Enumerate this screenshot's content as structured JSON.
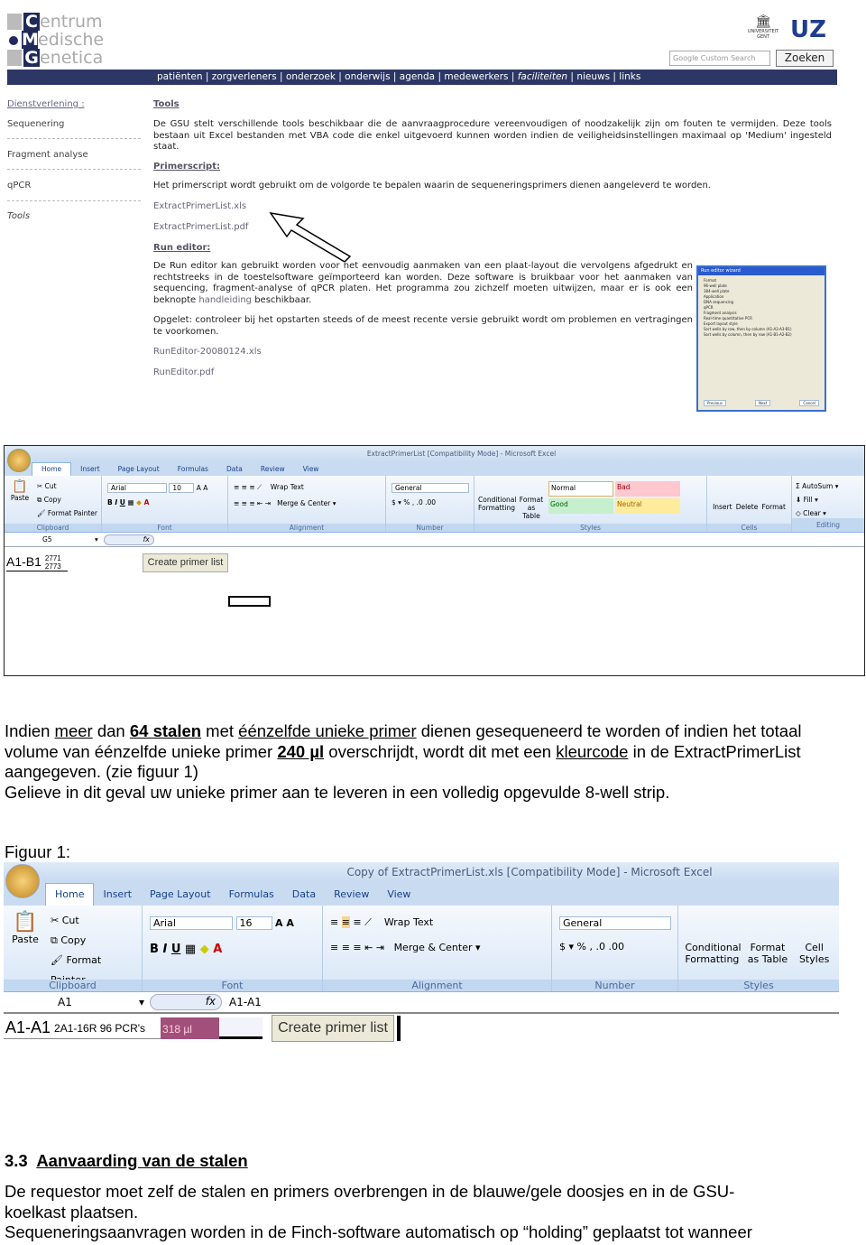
{
  "website": {
    "logo": {
      "line1_initial": "C",
      "line1_rest": "entrum",
      "line2_initial": "M",
      "line2_rest": "edische",
      "line3_initial": "G",
      "line3_rest": "enetica"
    },
    "university_logo": "UNIVERSITEIT GENT",
    "uz_logo": "UZ",
    "search_placeholder": "Google Custom Search",
    "search_button": "Zoeken",
    "nav": [
      "patiënten",
      "zorgverleners",
      "onderzoek",
      "onderwijs",
      "agenda",
      "medewerkers",
      "faciliteiten",
      "nieuws",
      "links"
    ],
    "sidebar": {
      "title": "Dienstverlening :",
      "items": [
        "Sequenering",
        "Fragment analyse",
        "qPCR",
        "Tools"
      ]
    },
    "content": {
      "title": "Tools",
      "intro": "De GSU stelt verschillende tools beschikbaar die de aanvraagprocedure vereenvoudigen of noodzakelijk zijn om fouten te vermijden. Deze tools bestaan uit Excel bestanden met VBA code die enkel uitgevoerd kunnen worden indien de veiligheidsinstellingen maximaal op 'Medium' ingesteld staat.",
      "primerscript_title": "Primerscript:",
      "primerscript_text": "Het primerscript wordt gebruikt om de volgorde te bepalen waarin de sequeneringsprimers dienen aangeleverd te worden.",
      "primer_links": [
        "ExtractPrimerList.xls",
        "ExtractPrimerList.pdf"
      ],
      "runeditor_title": "Run editor:",
      "runeditor_text_before": "De Run editor kan gebruikt worden voor het eenvoudig aanmaken van een plaat-layout die vervolgens afgedrukt en rechtstreeks in de toestelsoftware geïmporteerd kan worden. Deze software is bruikbaar voor het aanmaken van sequencing, fragment-analyse of qPCR platen. Het programma zou zichzelf moeten uitwijzen, maar er is ook een beknopte ",
      "runeditor_link": "handleiding",
      "runeditor_text_after": " beschikbaar.",
      "warning": "Opgelet: controleer bij het opstarten steeds of de meest recente versie gebruikt wordt om problemen en vertragingen te voorkomen.",
      "runeditor_links": [
        "RunEditor-20080124.xls",
        "RunEditor.pdf"
      ]
    },
    "dialog": {
      "title": "Run editor wizard",
      "format_label": "Format",
      "formats": [
        "96-well plate",
        "384-well plate"
      ],
      "application_label": "Application",
      "applications": [
        "DNA sequencing",
        "qPCR",
        "Fragment analysis",
        "Real-time quantitative PCR"
      ],
      "export_label": "Export layout style",
      "exports": [
        "Sort wells by row, then by column (A1-A2-A3-B1)",
        "Sort wells by column, then by row (A1-B1-A2-B2)"
      ],
      "buttons": [
        "Previous",
        "Next",
        "Cancel"
      ]
    }
  },
  "excel1": {
    "title": "ExtractPrimerList  [Compatibility Mode] - Microsoft Excel",
    "tabs": [
      "Home",
      "Insert",
      "Page Layout",
      "Formulas",
      "Data",
      "Review",
      "View"
    ],
    "clipboard": {
      "paste": "Paste",
      "cut": "Cut",
      "copy": "Copy",
      "format_painter": "Format Painter",
      "label": "Clipboard"
    },
    "font": {
      "name": "Arial",
      "size": "10",
      "label": "Font"
    },
    "alignment": {
      "wrap": "Wrap Text",
      "merge": "Merge & Center",
      "label": "Alignment"
    },
    "number": {
      "format": "General",
      "label": "Number"
    },
    "styles": {
      "conditional": "Conditional Formatting",
      "format_table": "Format as Table",
      "normal": "Normal",
      "bad": "Bad",
      "good": "Good",
      "neutral": "Neutral",
      "label": "Styles"
    },
    "cells": {
      "insert": "Insert",
      "delete": "Delete",
      "format": "Format",
      "label": "Cells"
    },
    "editing": {
      "autosum": "AutoSum",
      "fill": "Fill",
      "clear": "Clear",
      "label": "Editing"
    },
    "name_box": "G5",
    "fx": "fx",
    "cell_a1": "A1-B1",
    "cell_num1": "2771",
    "cell_num2": "2773",
    "button": "Create primer list"
  },
  "paragraph1": {
    "s1": "Indien ",
    "u1": "meer",
    " s2": "",
    "s2b": " dan ",
    "b1": "64 stalen",
    "s3": " met ",
    "u2": "éénzelfde unieke primer",
    "s4": " dienen gesequeneerd te worden of indien het totaal volume van éénzelfde unieke primer ",
    "b2": "240 µl",
    "s5": " overschrijdt, wordt dit met een ",
    "u3": "kleurcode",
    "s6": " in de ExtractPrimerList aangegeven. (zie figuur 1)",
    "line2": "Gelieve in dit geval uw unieke primer aan te leveren in een volledig opgevulde 8-well strip."
  },
  "figure_label": "Figuur 1:",
  "excel2": {
    "title": "Copy of ExtractPrimerList.xls  [Compatibility Mode] - Microsoft Excel",
    "tabs": [
      "Home",
      "Insert",
      "Page Layout",
      "Formulas",
      "Data",
      "Review",
      "View"
    ],
    "clipboard": {
      "paste": "Paste",
      "cut": "Cut",
      "copy": "Copy",
      "format_painter": "Format Painter",
      "label": "Clipboard"
    },
    "font": {
      "name": "Arial",
      "size": "16",
      "label": "Font"
    },
    "alignment": {
      "wrap": "Wrap Text",
      "merge": "Merge & Center",
      "label": "Alignment"
    },
    "number": {
      "format": "General",
      "label": "Number"
    },
    "styles": {
      "conditional": "Conditional Formatting",
      "format_table": "Format as Table",
      "cell_styles": "Cell Styles",
      "label": "Styles"
    },
    "name_box": "A1",
    "fx": "fx",
    "formula": "A1-A1",
    "cell_a1": "A1-A1",
    "cell_b1": "2A1-16R  96 PCR's",
    "cell_c1": "318 µl",
    "button": "Create primer list",
    "highlight_color": "#a0507a"
  },
  "section": {
    "number": "3.3",
    "title": "Aanvaarding van de stalen"
  },
  "paragraph2": {
    "line1": "De requestor moet zelf de stalen en primers overbrengen in de blauwe/gele doosjes en in de GSU-koelkast plaatsen.",
    "line2": "Sequeneringsaanvragen worden in de Finch-software automatisch op “holding” geplaatst tot wanneer"
  }
}
